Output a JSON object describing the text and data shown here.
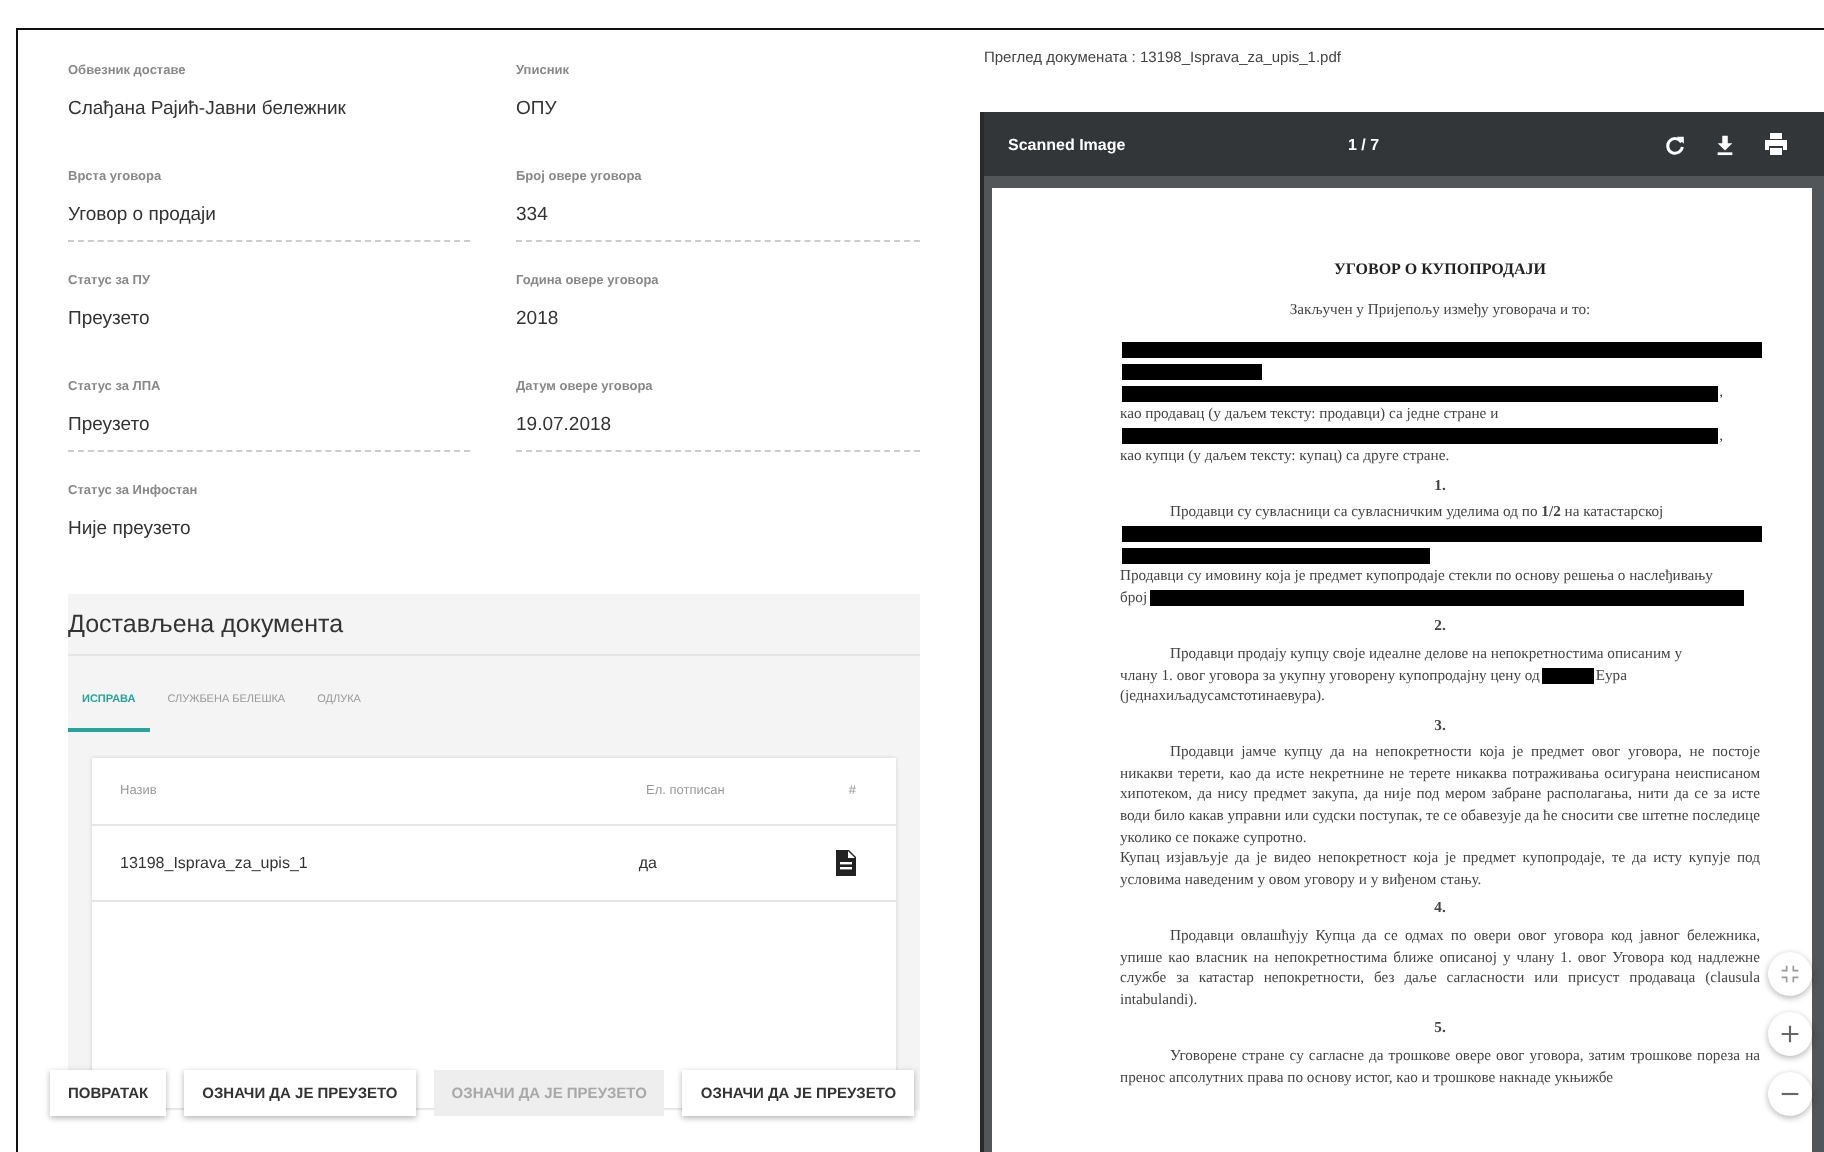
{
  "form": {
    "fields": [
      {
        "label": "Обвезник доставе",
        "value": "Слађана Рајић-Јавни бележник",
        "underlined": false
      },
      {
        "label": "Уписник",
        "value": "ОПУ",
        "underlined": false
      },
      {
        "label": "Врста уговора",
        "value": "Уговор о продаји",
        "underlined": true
      },
      {
        "label": "Број овере уговора",
        "value": "334",
        "underlined": true
      },
      {
        "label": "Статус за ПУ",
        "value": "Преузето",
        "underlined": false
      },
      {
        "label": "Година овере уговора",
        "value": "2018",
        "underlined": false
      },
      {
        "label": "Статус за ЛПА",
        "value": "Преузето",
        "underlined": true
      },
      {
        "label": "Датум овере уговора",
        "value": "19.07.2018",
        "underlined": true
      },
      {
        "label": "Статус за Инфостан",
        "value": "Није преузето",
        "underlined": false
      }
    ]
  },
  "documents_panel": {
    "title": "Достављена документа",
    "tabs": [
      {
        "label": "ИСПРАВА",
        "selected": true
      },
      {
        "label": "СЛУЖБЕНА БЕЛЕШКА",
        "selected": false
      },
      {
        "label": "ОДЛУКА",
        "selected": false
      }
    ],
    "table": {
      "columns": [
        "Назив",
        "Ел. потписан",
        "#"
      ],
      "rows": [
        {
          "name": "13198_Isprava_za_upis_1",
          "signed": "да"
        }
      ]
    }
  },
  "buttons": [
    {
      "label": "ПОВРАТАК",
      "disabled": false
    },
    {
      "label": "ОЗНАЧИ ДА ЈЕ ПРЕУЗЕТО",
      "disabled": false
    },
    {
      "label": "ОЗНАЧИ ДА ЈЕ ПРЕУЗЕТО",
      "disabled": true
    },
    {
      "label": "ОЗНАЧИ ДА ЈЕ ПРЕУЗЕТО",
      "disabled": false
    }
  ],
  "viewer": {
    "heading": "Преглед докумената : 13198_Isprava_za_upis_1.pdf",
    "toolbar": {
      "title": "Scanned Image",
      "page": "1 / 7"
    },
    "document": {
      "blocks": [
        {
          "kind": "title",
          "parts": [
            {
              "kind": "text",
              "text": "УГОВОР О КУПОПРОДАЈИ"
            }
          ]
        },
        {
          "kind": "center",
          "parts": [
            {
              "kind": "text",
              "text": "Закључен у Пријепољу између уговорача и то:"
            }
          ]
        },
        {
          "kind": "plain",
          "parts": [
            {
              "kind": "redaction_full"
            }
          ]
        },
        {
          "kind": "plain",
          "parts": [
            {
              "kind": "redaction_short"
            }
          ]
        },
        {
          "kind": "plain",
          "parts": [
            {
              "kind": "redaction_long"
            },
            {
              "kind": "text",
              "text": ","
            }
          ]
        },
        {
          "kind": "plain",
          "parts": [
            {
              "kind": "text",
              "text": "као продавац  (у даљем тексту: продавци) са једне стране и"
            }
          ]
        },
        {
          "kind": "plain",
          "parts": [
            {
              "kind": "redaction_long"
            },
            {
              "kind": "text",
              "text": ","
            }
          ]
        },
        {
          "kind": "plain",
          "parts": [
            {
              "kind": "text",
              "text": "као купци (у даљем тексту: купац) са друге стране."
            }
          ]
        },
        {
          "kind": "number",
          "parts": [
            {
              "kind": "text",
              "text": "1."
            }
          ]
        },
        {
          "kind": "indent",
          "parts": [
            {
              "kind": "text",
              "text": "Продавци су сувласници са сувласничким уделима од по **1/2** на катастарској"
            }
          ]
        },
        {
          "kind": "plain",
          "parts": [
            {
              "kind": "redaction_full"
            }
          ]
        },
        {
          "kind": "plain",
          "parts": [
            {
              "kind": "redaction_half"
            }
          ]
        },
        {
          "kind": "plain",
          "parts": [
            {
              "kind": "text",
              "text": "Продавци су имовину која је предмет купопродаје стекли по основу решења о наслеђивању"
            }
          ]
        },
        {
          "kind": "plain",
          "parts": [
            {
              "kind": "text",
              "text": "број"
            },
            {
              "kind": "redaction_long"
            }
          ]
        },
        {
          "kind": "number",
          "parts": [
            {
              "kind": "text",
              "text": "2."
            }
          ]
        },
        {
          "kind": "indent",
          "parts": [
            {
              "kind": "text",
              "text": "Продавци продају купцу своје идеалне делове на непокретностима описаним  у"
            }
          ]
        },
        {
          "kind": "plain",
          "parts": [
            {
              "kind": "text",
              "text": "члану 1. овог уговора за укупну уговорену купопродајну цену од"
            },
            {
              "kind": "redaction_word"
            },
            {
              "kind": "text",
              "text": "Еура"
            }
          ]
        },
        {
          "kind": "plain",
          "parts": [
            {
              "kind": "text",
              "text": "(једнахиљадусамстотинаевура)."
            }
          ]
        },
        {
          "kind": "number",
          "parts": [
            {
              "kind": "text",
              "text": "3."
            }
          ]
        },
        {
          "kind": "indent",
          "parts": [
            {
              "kind": "text",
              "text": "Продавци јамче купцу да на непокретности која је предмет овог уговора, не постоје никакви терети, као да исте некретнине не терете никаква потраживања осигурана неисписаном хипотеком, да нису предмет закупа, да није под мером забране располагања, нити да се за исте води било какав управни или судски поступак, те се обавезује да ће сносити све штетне последице уколико се покаже супротно."
            }
          ]
        },
        {
          "kind": "para",
          "parts": [
            {
              "kind": "text",
              "text": "Купац изјављује да је видео непокретност  која је предмет купопродаје, те да исту купује под условима наведеним у овом уговору и у виђеном стању."
            }
          ]
        },
        {
          "kind": "number",
          "parts": [
            {
              "kind": "text",
              "text": "4."
            }
          ]
        },
        {
          "kind": "indent",
          "parts": [
            {
              "kind": "text",
              "text": "Продавци овлашћују Купца да се одмах по овери овог уговора код јавног бележника, упише као власник на непокретностима ближе описаној у члану 1. овог Уговора код надлежне службе за катастар непокретности, без даље сагласности или присуст продаваца (clausula intabulandi)."
            }
          ]
        },
        {
          "kind": "number",
          "parts": [
            {
              "kind": "text",
              "text": "5."
            }
          ]
        },
        {
          "kind": "indent",
          "parts": [
            {
              "kind": "text",
              "text": "Уговорене стране су сагласне да трошкове овере овог уговора, затим трошкове пореза на пренос апсолутних права по основу истог, као и трошкове накнаде укњижбе"
            }
          ]
        }
      ]
    }
  }
}
